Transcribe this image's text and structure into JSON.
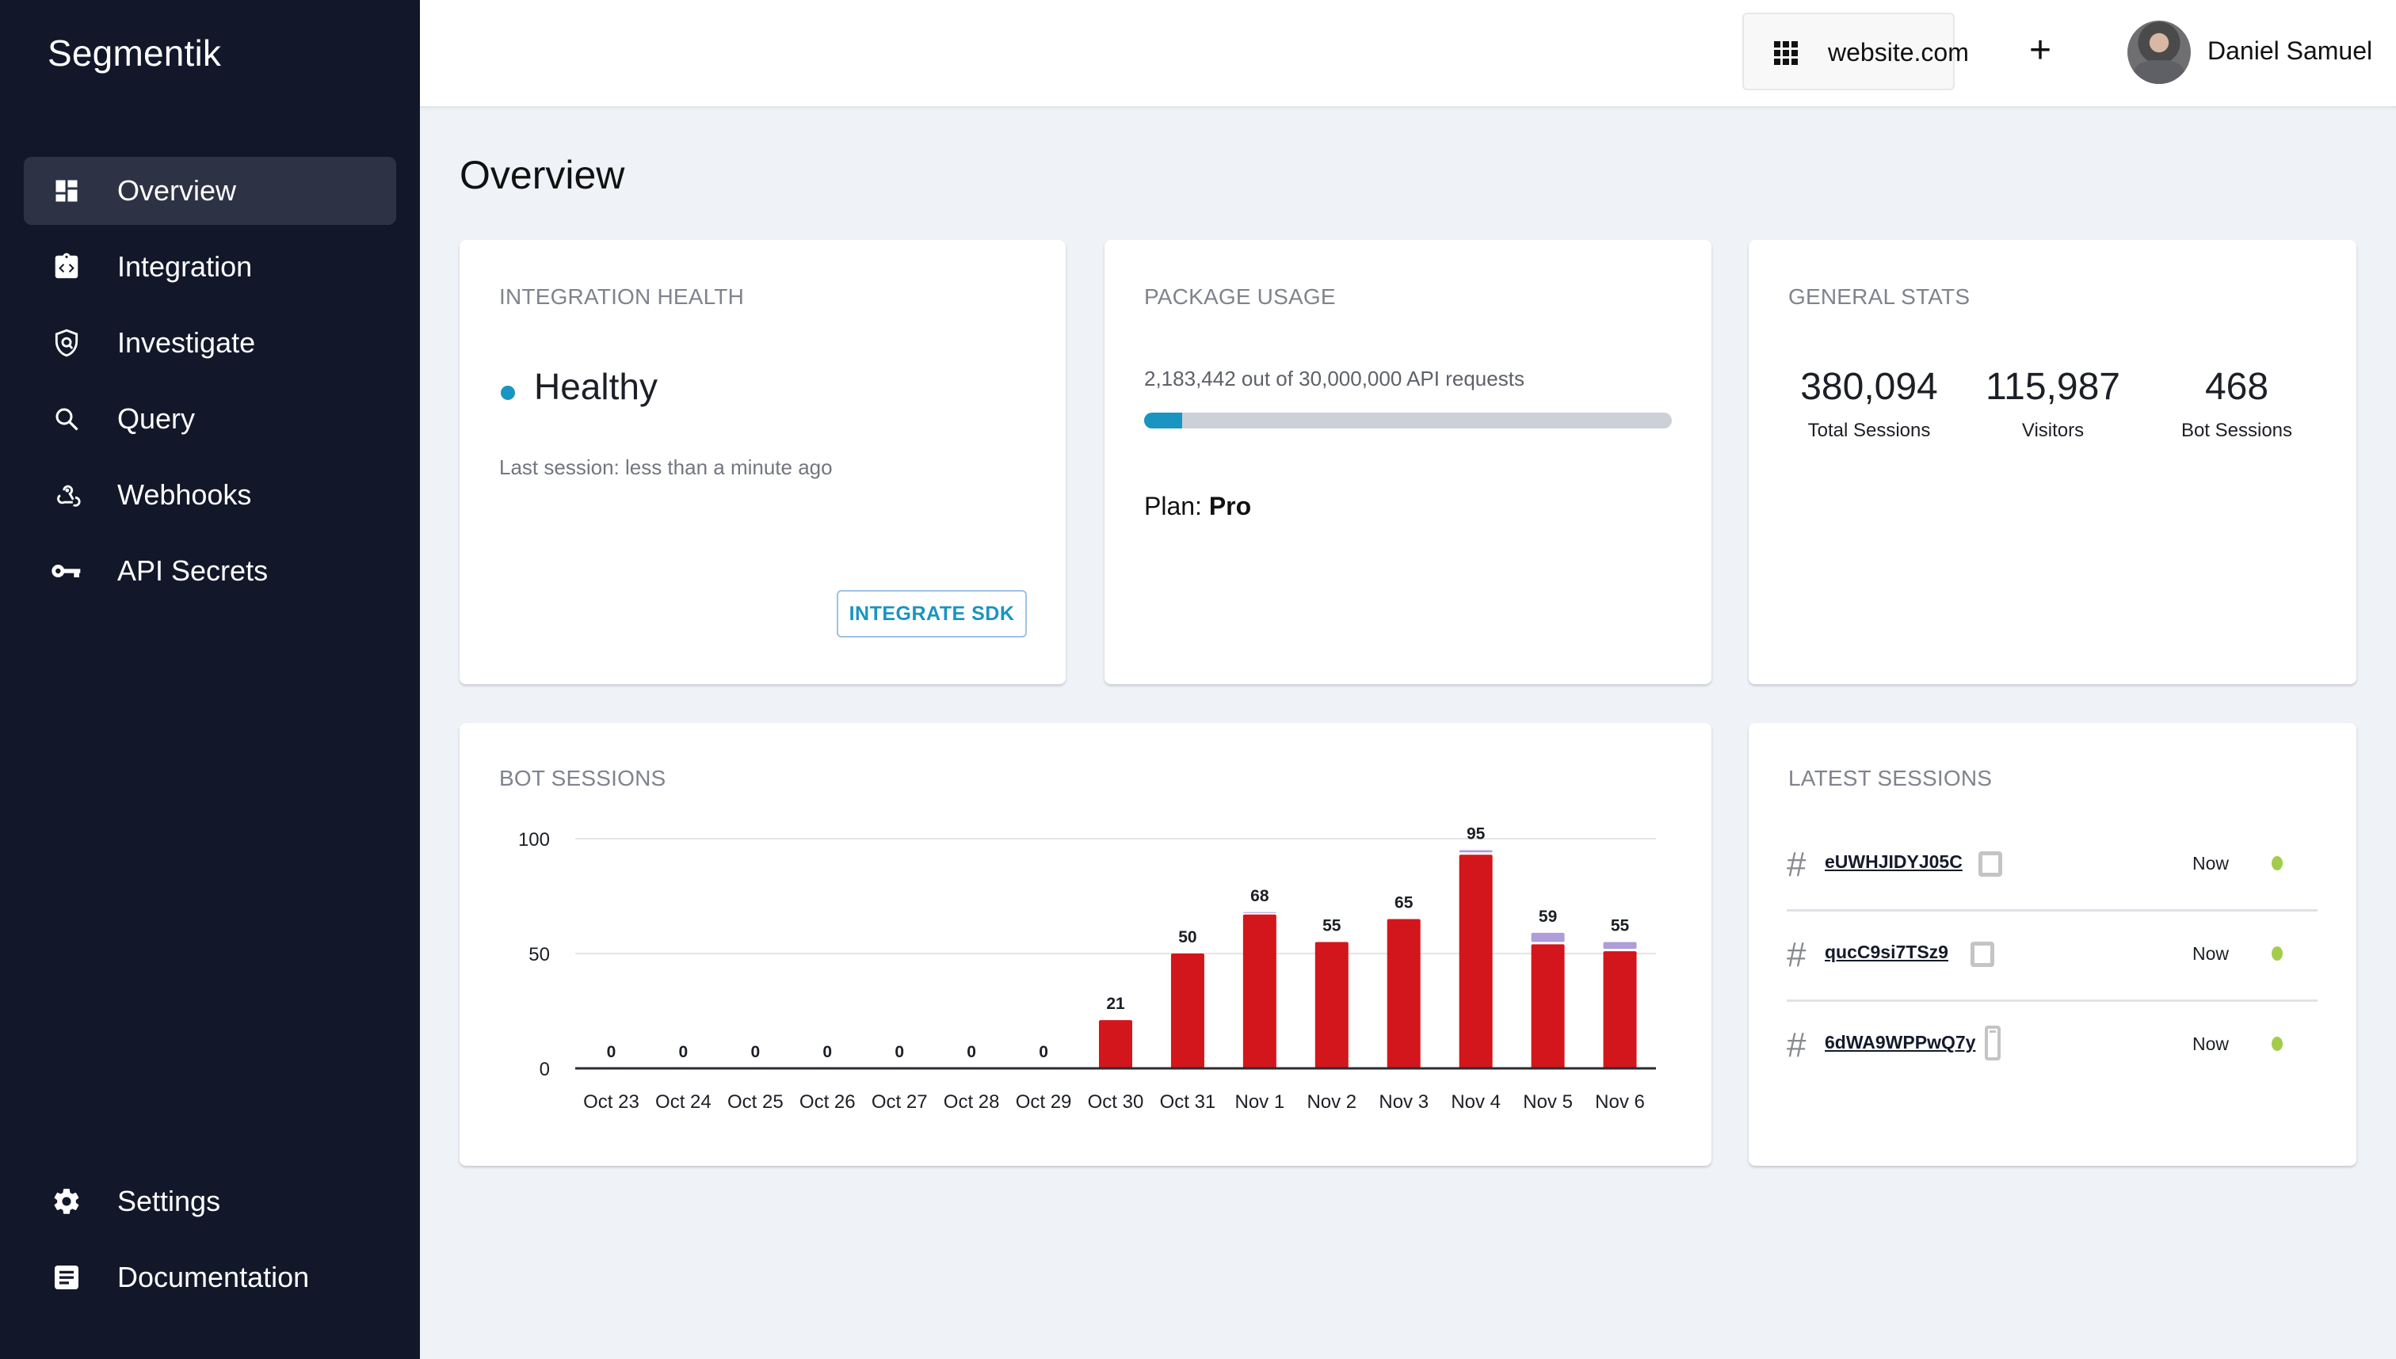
{
  "app": {
    "title": "Segmentik"
  },
  "sidebar": {
    "items": [
      {
        "label": "Overview",
        "icon": "dashboard-icon",
        "active": true
      },
      {
        "label": "Integration",
        "icon": "code-clipboard-icon",
        "active": false
      },
      {
        "label": "Investigate",
        "icon": "shield-search-icon",
        "active": false
      },
      {
        "label": "Query",
        "icon": "search-icon",
        "active": false
      },
      {
        "label": "Webhooks",
        "icon": "webhook-icon",
        "active": false
      },
      {
        "label": "API Secrets",
        "icon": "key-icon",
        "active": false
      }
    ],
    "bottom_items": [
      {
        "label": "Settings",
        "icon": "gear-icon"
      },
      {
        "label": "Documentation",
        "icon": "document-icon"
      }
    ]
  },
  "header": {
    "site": "website.com",
    "site_icon": "apps-grid-icon",
    "add_icon": "plus-icon",
    "user_name": "Daniel Samuel"
  },
  "page": {
    "title": "Overview"
  },
  "integration_health": {
    "title": "INTEGRATION HEALTH",
    "status": "Healthy",
    "status_color": "#1a94c0",
    "last_session": "Last session: less than a minute ago",
    "button_label": "INTEGRATE SDK"
  },
  "package_usage": {
    "title": "PACKAGE USAGE",
    "used": "2,183,442",
    "usage_suffix": " out of 30,000,000 API requests",
    "progress_percent": 7.28,
    "plan_label": "Plan: ",
    "plan_value": "Pro"
  },
  "general_stats": {
    "title": "GENERAL STATS",
    "stats": [
      {
        "value": "380,094",
        "label": "Total Sessions"
      },
      {
        "value": "115,987",
        "label": "Visitors"
      },
      {
        "value": "468",
        "label": "Bot Sessions"
      }
    ]
  },
  "bot_sessions": {
    "title": "BOT SESSIONS"
  },
  "chart_data": {
    "type": "bar",
    "stacked": true,
    "title": "BOT SESSIONS",
    "xlabel": "",
    "ylabel": "",
    "ylim": [
      0,
      100
    ],
    "yticks": [
      0,
      50,
      100
    ],
    "grid": true,
    "categories": [
      "Oct 23",
      "Oct 24",
      "Oct 25",
      "Oct 26",
      "Oct 27",
      "Oct 28",
      "Oct 29",
      "Oct 30",
      "Oct 31",
      "Nov 1",
      "Nov 2",
      "Nov 3",
      "Nov 4",
      "Nov 5",
      "Nov 6"
    ],
    "totals": [
      0,
      0,
      0,
      0,
      0,
      0,
      0,
      21,
      50,
      68,
      55,
      65,
      95,
      59,
      55
    ],
    "series": [
      {
        "name": "primary",
        "color": "#d3161b",
        "values": [
          0,
          0,
          0,
          0,
          0,
          0,
          0,
          21,
          50,
          67,
          55,
          65,
          93,
          54,
          51
        ]
      },
      {
        "name": "secondary",
        "color": "#b09cd8",
        "values": [
          0,
          0,
          0,
          0,
          0,
          0,
          0,
          0,
          0,
          1,
          0,
          0,
          2,
          5,
          4
        ]
      }
    ]
  },
  "latest_sessions": {
    "title": "LATEST SESSIONS",
    "rows": [
      {
        "id": "eUWHJIDYJ05C",
        "device": "desktop",
        "time": "Now",
        "status_color": "#a4cc4c"
      },
      {
        "id": "qucC9si7TSz9",
        "device": "desktop",
        "time": "Now",
        "status_color": "#a4cc4c"
      },
      {
        "id": "6dWA9WPPwQ7y",
        "device": "mobile",
        "time": "Now",
        "status_color": "#a4cc4c"
      }
    ]
  }
}
